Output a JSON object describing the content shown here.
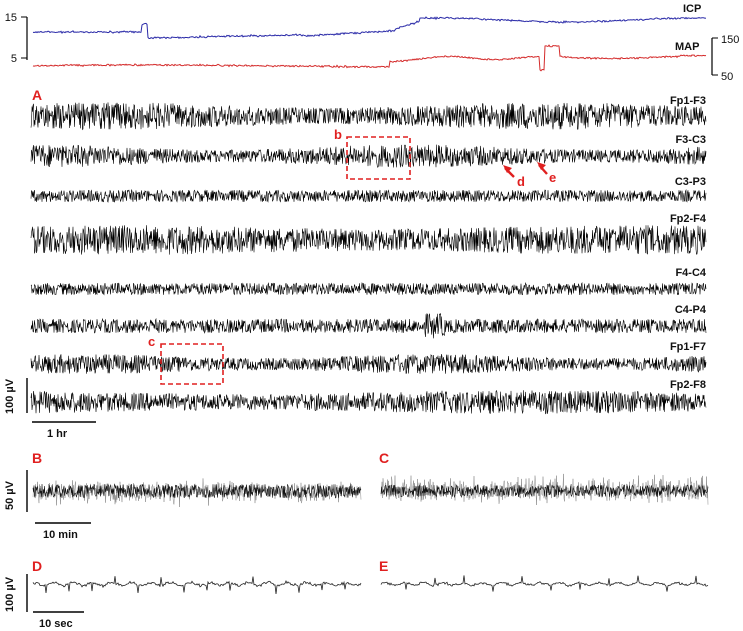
{
  "chart_data": {
    "type": "line",
    "vitals": {
      "series": [
        {
          "name": "ICP",
          "color": "#2a2aa8",
          "axis_ticks": [
            "15",
            "5"
          ]
        },
        {
          "name": "MAP",
          "color": "#d42a2a",
          "axis_ticks": [
            "150",
            "50"
          ]
        }
      ]
    },
    "panels": [
      {
        "id": "A",
        "label": "A",
        "channels": [
          "Fp1-F3",
          "F3-C3",
          "C3-P3",
          "Fp2-F4",
          "F4-C4",
          "C4-P4",
          "Fp1-F7",
          "Fp2-F8"
        ],
        "amplitude_scale": "100 µV",
        "time_scale": "1 hr",
        "boxes": [
          {
            "label": "b",
            "channel": "F3-C3"
          },
          {
            "label": "c",
            "channel": "Fp1-F7"
          }
        ],
        "arrows": [
          "d",
          "e"
        ]
      },
      {
        "id": "B",
        "label": "B",
        "amplitude_scale": "50 µV",
        "time_scale": "10 min"
      },
      {
        "id": "C",
        "label": "C"
      },
      {
        "id": "D",
        "label": "D",
        "amplitude_scale": "100 µV",
        "time_scale": "10 sec"
      },
      {
        "id": "E",
        "label": "E"
      }
    ]
  }
}
